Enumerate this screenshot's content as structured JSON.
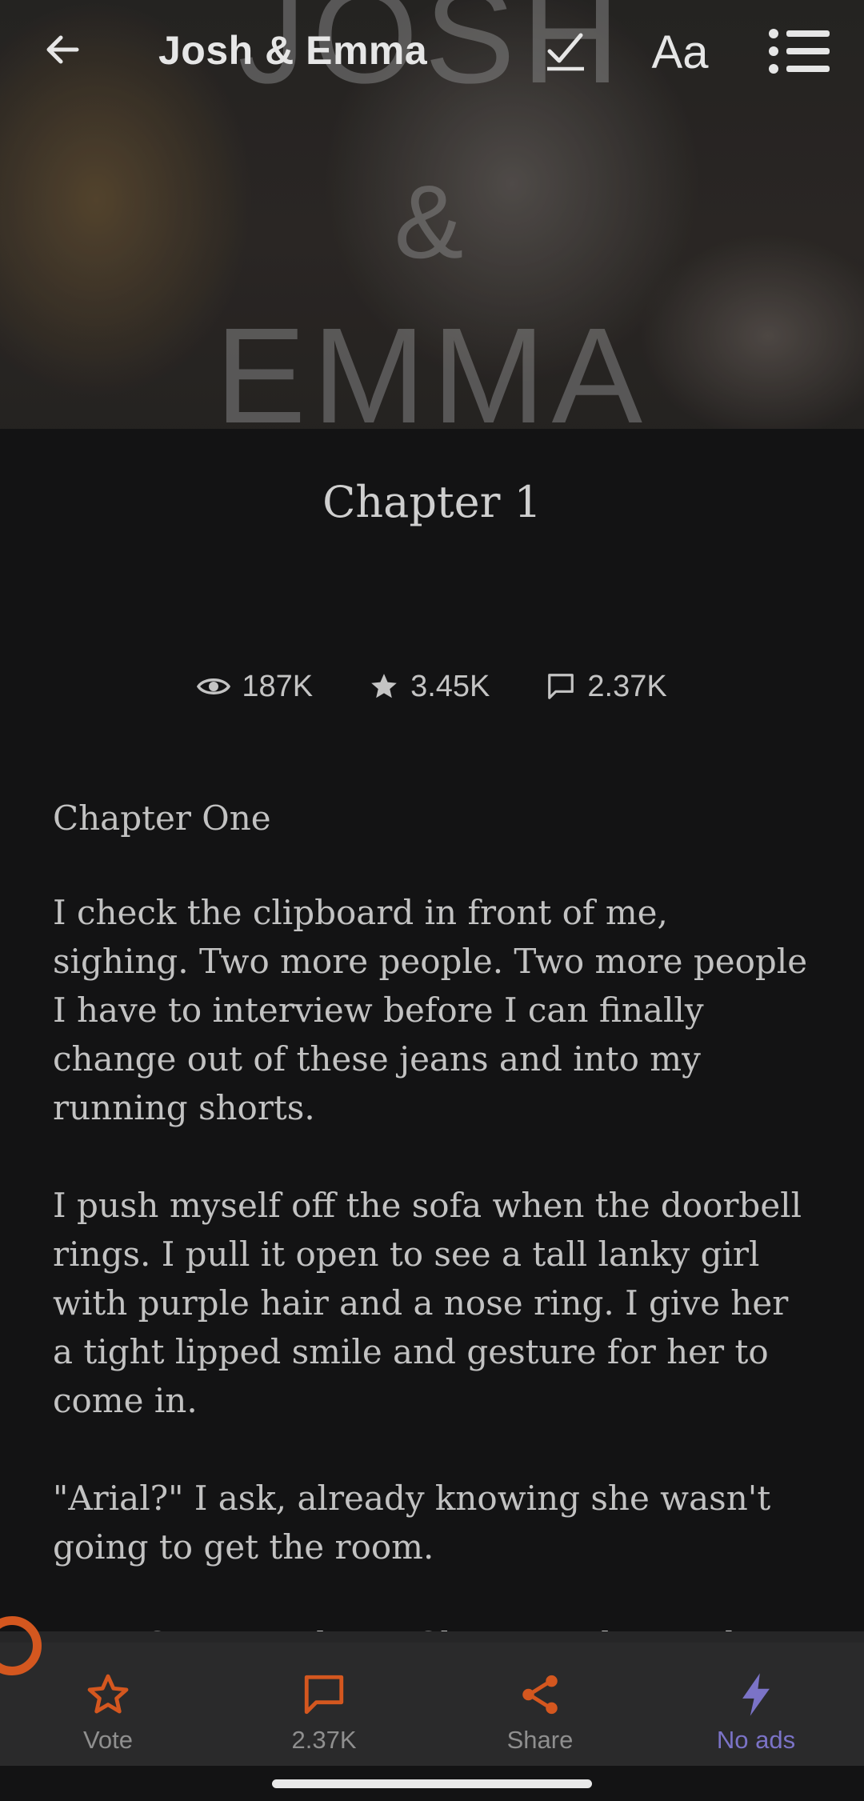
{
  "header": {
    "title": "Josh & Emma",
    "cover_text": {
      "line1": "JOSH",
      "line2": "&",
      "line3": "EMMA"
    },
    "font_button_label": "Aa"
  },
  "chapter": {
    "title": "Chapter 1",
    "stats": {
      "reads": "187K",
      "votes": "3.45K",
      "comments": "2.37K"
    }
  },
  "story": {
    "paragraphs": [
      "Chapter One",
      "I check the clipboard in front of me, sighing. Two more people. Two more people I have to interview before I can finally change out of these jeans and into my running shorts.",
      "I push myself off the sofa when the doorbell rings. I pull it open to see a tall lanky girl with purple hair and a nose ring. I give her a tight lipped smile and gesture for her to come in.",
      "\"Arial?\" I ask, already knowing she wasn't going to get the room.",
      "\"Yes, Sorry I'm late,\" She says, the wind"
    ]
  },
  "bottom_bar": {
    "vote_label": "Vote",
    "comments_label": "2.37K",
    "share_label": "Share",
    "noads_label": "No ads"
  },
  "colors": {
    "accent_orange": "#d4571f",
    "accent_purple": "#7b73c7",
    "background": "#131314"
  },
  "icons": [
    "back-arrow-icon",
    "checkmark-icon",
    "font-size-icon",
    "table-of-contents-icon",
    "eye-icon",
    "star-icon",
    "comment-icon",
    "share-icon",
    "lightning-icon"
  ]
}
